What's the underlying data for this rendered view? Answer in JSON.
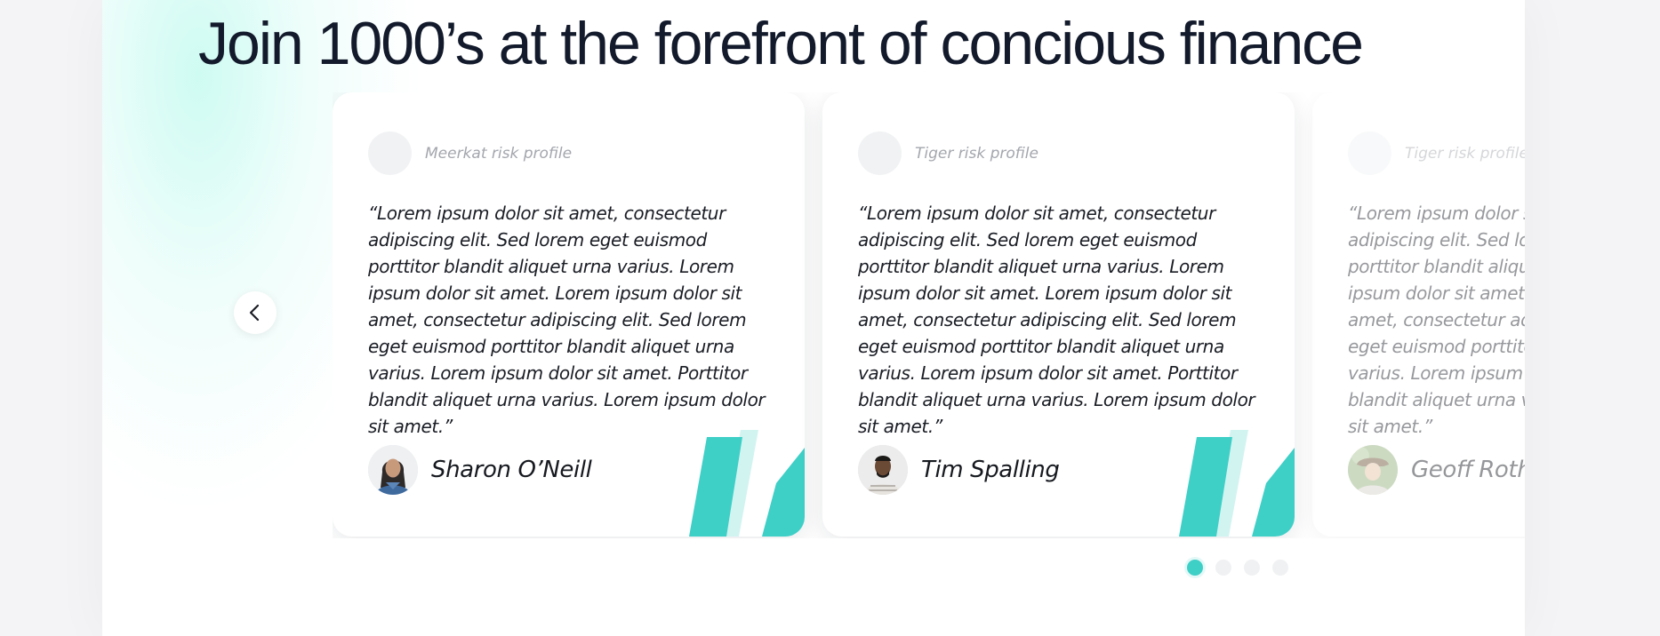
{
  "headline": "Join 1000’s at the forefront of concious finance",
  "accent_color": "#3ecfc6",
  "accent_light_color": "#d2f4f1",
  "carousel": {
    "prev_icon": "chevron-left-icon",
    "cards": [
      {
        "profile_label": "Meerkat risk profile",
        "quote": "“Lorem ipsum dolor sit amet, consectetur adipiscing elit. Sed lorem eget euismod porttitor blandit aliquet urna varius. Lorem ipsum dolor sit amet. Lorem ipsum dolor sit amet, consectetur adipiscing elit. Sed lorem eget euismod porttitor blandit aliquet urna varius. Lorem ipsum dolor sit amet. Porttitor blandit aliquet urna varius. Lorem ipsum dolor sit amet.”",
        "author": "Sharon O’Neill"
      },
      {
        "profile_label": "Tiger risk profile",
        "quote": "“Lorem ipsum dolor sit amet, consectetur adipiscing elit. Sed lorem eget euismod porttitor blandit aliquet urna varius. Lorem ipsum dolor sit amet. Lorem ipsum dolor sit amet, consectetur adipiscing elit. Sed lorem eget euismod porttitor blandit aliquet urna varius. Lorem ipsum dolor sit amet. Porttitor blandit aliquet urna varius. Lorem ipsum dolor sit amet.”",
        "author": "Tim Spalling"
      },
      {
        "profile_label": "Tiger risk profile",
        "quote": "“Lorem ipsum dolor sit amet, consectetur adipiscing elit. Sed lorem eget euismod porttitor blandit aliquet urna varius. Lorem ipsum dolor sit amet. Lorem ipsum dolor sit amet, consectetur adipiscing elit. Sed lorem eget euismod porttitor blandit aliquet urna varius. Lorem ipsum dolor sit amet. Porttitor blandit aliquet urna varius. Lorem ipsum dolor sit amet.”",
        "author": "Geoff Rothe"
      }
    ],
    "pagination": {
      "count": 4,
      "active_index": 0
    }
  }
}
